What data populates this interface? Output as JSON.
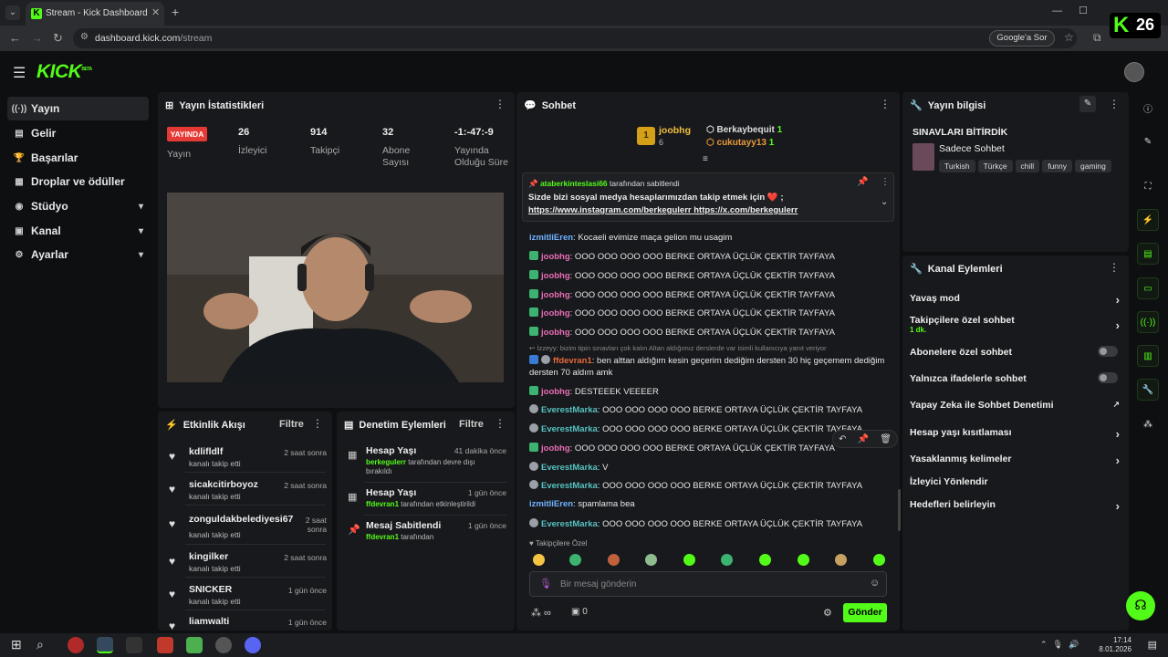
{
  "browser": {
    "tab_title": "Stream - Kick Dashboard",
    "url_host": "dashboard.kick.com",
    "url_path": "/stream",
    "google_btn": "Google'a Sor",
    "badge_letter": "K",
    "badge_number": "26"
  },
  "brand": {
    "logo": "KICK",
    "beta": "BETA"
  },
  "sidebar": {
    "items": [
      {
        "label": "Yayın",
        "icon": "broadcast-icon"
      },
      {
        "label": "Gelir",
        "icon": "revenue-icon"
      },
      {
        "label": "Başarılar",
        "icon": "trophy-icon"
      },
      {
        "label": "Droplar ve ödüller",
        "icon": "gift-icon"
      },
      {
        "label": "Stüdyo",
        "icon": "studio-icon"
      },
      {
        "label": "Kanal",
        "icon": "channel-icon"
      },
      {
        "label": "Ayarlar",
        "icon": "gear-icon"
      }
    ]
  },
  "stats": {
    "title": "Yayın İstatistikleri",
    "status": "YAYINDA",
    "status_label": "Yayın",
    "viewers": "26",
    "viewers_label": "İzleyici",
    "followers": "914",
    "followers_label": "Takipçi",
    "subs": "32",
    "subs_label": "Abone Sayısı",
    "uptime": "-1:-47:-9",
    "uptime_label": "Yayında Olduğu Süre"
  },
  "events": {
    "title": "Etkinlik Akışı",
    "filter": "Filtre",
    "items": [
      {
        "name": "kdlifldlf",
        "sub": "kanalı takip etti",
        "time": "2 saat sonra"
      },
      {
        "name": "sicakcitirboyoz",
        "sub": "kanalı takip etti",
        "time": "2 saat sonra"
      },
      {
        "name": "zonguldakbelediyesi67",
        "sub": "kanalı takip etti",
        "time": "2 saat sonra"
      },
      {
        "name": "kingilker",
        "sub": "kanalı takip etti",
        "time": "2 saat sonra"
      },
      {
        "name": "SNICKER",
        "sub": "kanalı takip etti",
        "time": "1 gün önce"
      },
      {
        "name": "liamwalti",
        "sub": "",
        "time": "1 gün önce"
      }
    ]
  },
  "moderation": {
    "title": "Denetim Eylemleri",
    "filter": "Filtre",
    "items": [
      {
        "title": "Hesap Yaşı",
        "time": "41 dakika önce",
        "user": "berkegulerr",
        "rest": " tarafından devre dışı bırakıldı"
      },
      {
        "title": "Hesap Yaşı",
        "time": "1 gün önce",
        "user": "ffdevran1",
        "rest": " tarafından etkinleştirildi"
      },
      {
        "title": "Mesaj Sabitlendi",
        "time": "1 gün önce",
        "user": "ffdevran1",
        "rest": " tarafından"
      }
    ]
  },
  "chat": {
    "title": "Sohbet",
    "leaderboard": [
      {
        "rank": "1",
        "name": "joobhg",
        "count": "6"
      },
      {
        "name": "Berkaybequit",
        "count": "1"
      },
      {
        "name": "cukutayy13",
        "count": "1"
      }
    ],
    "pinned": {
      "by": "ataberkinteslasi66",
      "by_suffix": "tarafından sabitlendi",
      "text": "Sizde bizi sosyal medya hesaplarımızdan takip etmek için ❤️ ;",
      "link1": "https://www.instagram.com/berkegulerr",
      "link2": "https://x.com/berkegulerr"
    },
    "messages": [
      {
        "user": "izmitliEren",
        "text": ": Kocaeli evimize maça gelion mu usagim"
      },
      {
        "user": "joobhg",
        "text": ": OOO OOO OOO OOO BERKE ORTAYA ÜÇLÜK ÇEKTİR TAYFAYA"
      },
      {
        "user": "joobhg",
        "text": ": OOO OOO OOO OOO BERKE ORTAYA ÜÇLÜK ÇEKTİR TAYFAYA"
      },
      {
        "user": "joobhg",
        "text": ": OOO OOO OOO OOO BERKE ORTAYA ÜÇLÜK ÇEKTİR TAYFAYA"
      },
      {
        "user": "joobhg",
        "text": ": OOO OOO OOO OOO BERKE ORTAYA ÜÇLÜK ÇEKTİR TAYFAYA"
      },
      {
        "user": "joobhg",
        "text": ": OOO OOO OOO OOO BERKE ORTAYA ÜÇLÜK ÇEKTİR TAYFAYA"
      }
    ],
    "reply_ctx": "İzzeyy: bizim tipin sınavları çok kalın Altan aldığımız derslerde var isimli kullanıcıya yanıt veriyor",
    "reply_user": "ffdevran1",
    "reply_text": ": ben alttan aldığım kesin geçerim dediğim dersten 30 hiç geçemem dediğim",
    "reply_text2": "dersten 70 aldım amk",
    "messages2": [
      {
        "user": "joobhg",
        "text": ": DESTEEEK VEEEER"
      },
      {
        "user": "EverestMarka",
        "text": ": OOO OOO OOO OOO BERKE ORTAYA ÜÇLÜK ÇEKTİR TAYFAYA"
      },
      {
        "user": "EverestMarka",
        "text": ": OOO OOO OOO OOO BERKE ORTAYA ÜÇLÜK ÇEKTİR TAYFAYA"
      },
      {
        "user": "joobhg",
        "text": ": OOO OOO OOO OOO BERKE ORTAYA ÜÇLÜK ÇEKTİR TAYFAYA"
      },
      {
        "user": "EverestMarka",
        "text": ": V"
      },
      {
        "user": "EverestMarka",
        "text": ": OOO OOO OOO OOO BERKE ORTAYA ÜÇLÜK ÇEKTİR TAYFAYA"
      },
      {
        "user": "izmitliEren",
        "text": ": spamlama bea"
      },
      {
        "user": "EverestMarka",
        "text": ": OOO OOO OOO OOO BERKE ORTAYA ÜÇLÜK ÇEKTİR TAYFAYA"
      }
    ],
    "mode": "Takipçilere Özel",
    "placeholder": "Bir mesaj gönderin",
    "points": "0",
    "send": "Gönder"
  },
  "stream_info": {
    "title": "Yayın bilgisi",
    "stream_title": "SINAVLARI BİTİRDİK",
    "category": "Sadece Sohbet",
    "tags": [
      "Turkish",
      "Türkçe",
      "chill",
      "funny",
      "gaming"
    ]
  },
  "channel_actions": {
    "title": "Kanal Eylemleri",
    "items": [
      {
        "label": "Yavaş mod",
        "kind": "arrow"
      },
      {
        "label": "Takipçilere özel sohbet",
        "sub": "1 dk.",
        "kind": "arrow"
      },
      {
        "label": "Abonelere özel sohbet",
        "kind": "toggle"
      },
      {
        "label": "Yalnızca ifadelerle sohbet",
        "kind": "toggle"
      },
      {
        "label": "Yapay Zeka ile Sohbet Denetimi",
        "kind": "external"
      },
      {
        "label": "Hesap yaşı kısıtlaması",
        "kind": "arrow"
      },
      {
        "label": "Yasaklanmış kelimeler",
        "kind": "arrow"
      },
      {
        "label": "İzleyici Yönlendir",
        "kind": "none"
      },
      {
        "label": "Hedefleri belirleyin",
        "kind": "arrow"
      }
    ]
  },
  "taskbar": {
    "time": "17:14",
    "date": "8.01.2026"
  },
  "colors": {
    "accent": "#53fc18",
    "live": "#e53935",
    "panel": "#18191c",
    "bg": "#0e0f11"
  }
}
